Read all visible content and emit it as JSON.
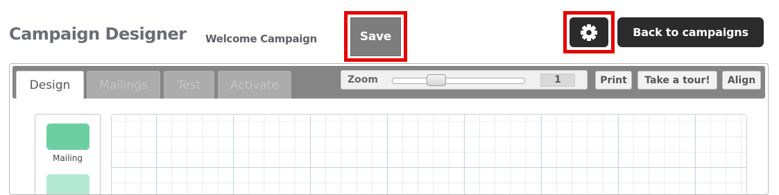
{
  "header": {
    "app_title": "Campaign Designer",
    "campaign_name": "Welcome Campaign",
    "save_label": "Save",
    "settings_icon": "gear-icon",
    "back_label": "Back to campaigns"
  },
  "tabs": [
    {
      "label": "Design",
      "active": true
    },
    {
      "label": "Mailings",
      "active": false
    },
    {
      "label": "Test",
      "active": false
    },
    {
      "label": "Activate",
      "active": false
    }
  ],
  "zoom": {
    "label": "Zoom",
    "value": "1",
    "slider_min": 0,
    "slider_max": 3,
    "slider_value": 1
  },
  "toolbar": {
    "print_label": "Print",
    "tour_label": "Take a tour!",
    "align_label": "Align"
  },
  "palette": {
    "items": [
      {
        "label": "Mailing",
        "color": "#6ccfa2"
      },
      {
        "label": "",
        "color": "#b4ead3"
      }
    ]
  },
  "colors": {
    "highlight": "#e60000",
    "save_button": "#7d7d7d",
    "dark_button": "#2b2b2b",
    "tabbar": "#858585"
  }
}
